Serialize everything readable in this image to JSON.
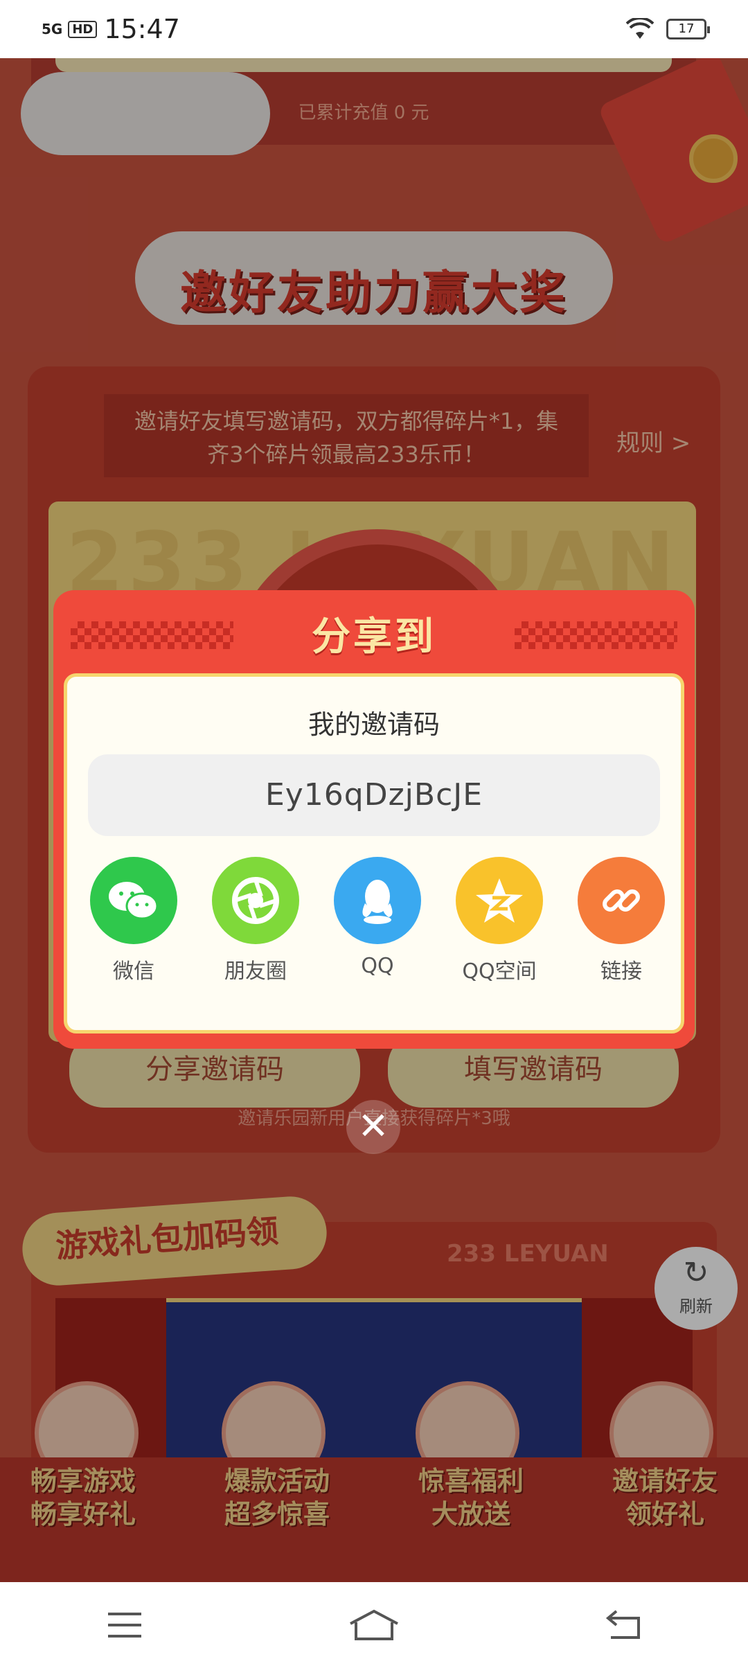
{
  "status_bar": {
    "signal": "5G",
    "hd": "HD",
    "time": "15:47",
    "battery": "17"
  },
  "background": {
    "recharge_text": "已累计充值 0 元",
    "banner_title": "邀好友助力赢大奖",
    "invite_text": "邀请好友填写邀请码，双方都得碎片*1，集齐3个碎片领最高233乐币！",
    "rules_link": "规则 >",
    "watermark": "233 LEYUAN",
    "share_code_button": "分享邀请码",
    "fill_code_button": "填写邀请码",
    "invite_note": "邀请乐园新用户直接获得碎片*3哦",
    "gift_title": "游戏礼包加码领",
    "leyuan_label": "233 LEYUAN",
    "promos": [
      {
        "line1": "畅享游戏",
        "line2": "畅享好礼"
      },
      {
        "line1": "爆款活动",
        "line2": "超多惊喜"
      },
      {
        "line1": "惊喜福利",
        "line2": "大放送"
      },
      {
        "line1": "邀请好友",
        "line2": "领好礼"
      }
    ],
    "refresh_label": "刷新"
  },
  "dialog": {
    "title": "分享到",
    "code_label": "我的邀请码",
    "code_value": "Ey16qDzjBcJE",
    "share_targets": [
      {
        "label": "微信",
        "icon": "wechat-icon",
        "color": "#2fc84c"
      },
      {
        "label": "朋友圈",
        "icon": "moments-icon",
        "color": "#7fd93a"
      },
      {
        "label": "QQ",
        "icon": "qq-icon",
        "color": "#3aa9f0"
      },
      {
        "label": "QQ空间",
        "icon": "qzone-icon",
        "color": "#f9c22b"
      },
      {
        "label": "链接",
        "icon": "link-icon",
        "color": "#f57c3b"
      }
    ]
  },
  "nav_bar": {
    "icons": [
      "menu-icon",
      "home-icon",
      "back-icon"
    ]
  },
  "colors": {
    "dialog_red": "#ef4a3b",
    "gold": "#f6d56e",
    "cream": "#fffdf3"
  }
}
